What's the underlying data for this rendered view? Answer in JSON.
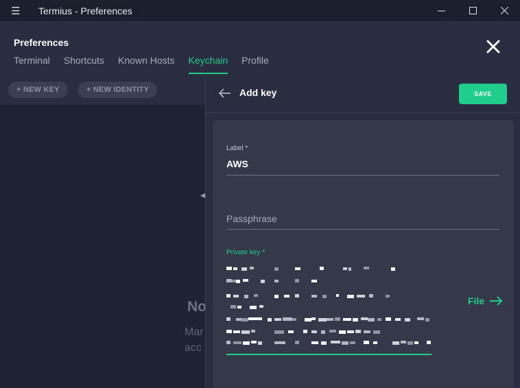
{
  "window": {
    "title": "Termius - Preferences",
    "menu_icon": "hamburger-icon",
    "controls": [
      "minimize-icon",
      "maximize-icon",
      "close-icon"
    ]
  },
  "header": {
    "title": "Preferences",
    "tabs": [
      {
        "label": "Terminal",
        "active": false
      },
      {
        "label": "Shortcuts",
        "active": false
      },
      {
        "label": "Known Hosts",
        "active": false
      },
      {
        "label": "Keychain",
        "active": true
      },
      {
        "label": "Profile",
        "active": false
      }
    ],
    "close_icon": "close-icon"
  },
  "keychain": {
    "new_key_label": "+ NEW KEY",
    "new_identity_label": "+ NEW IDENTITY",
    "empty_title": "No",
    "empty_desc_line1": "Mar",
    "empty_desc_line2": "acc"
  },
  "add_key": {
    "title": "Add key",
    "save_label": "SAVE",
    "label_field": {
      "label": "Label *",
      "value": "AWS"
    },
    "passphrase_field": {
      "placeholder": "Passphrase"
    },
    "private_key_field": {
      "label": "Private key *"
    },
    "file_label": "File"
  },
  "colors": {
    "accent": "#1fce8b",
    "background": "#1f2233",
    "panel": "#2a2d3f",
    "card": "#353848"
  }
}
